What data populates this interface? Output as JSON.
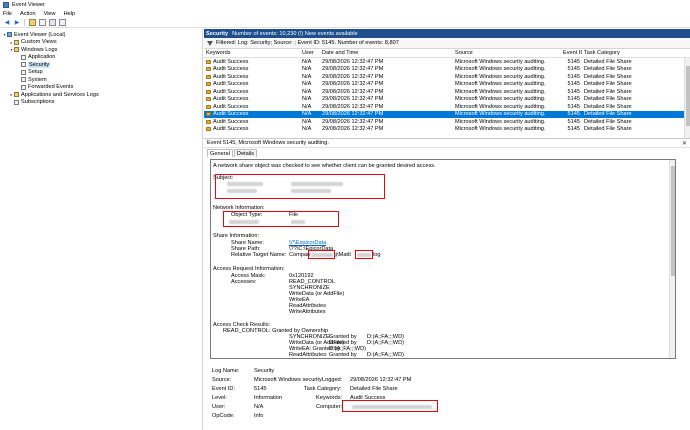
{
  "window": {
    "title": "Event Viewer"
  },
  "menu": [
    "File",
    "Action",
    "View",
    "Help"
  ],
  "toolbar": {
    "icons": [
      "back-arrow-icon",
      "forward-arrow-icon",
      "folder-icon",
      "properties-icon",
      "help-icon",
      "console-icon"
    ]
  },
  "tree": [
    {
      "label": "Event Viewer (Local)",
      "level": 0,
      "caret": "▾",
      "icon": "root"
    },
    {
      "label": "Custom Views",
      "level": 1,
      "caret": "▸",
      "icon": "folder"
    },
    {
      "label": "Windows Logs",
      "level": 1,
      "caret": "▾",
      "icon": "folder"
    },
    {
      "label": "Application",
      "level": 2,
      "caret": "",
      "icon": "log"
    },
    {
      "label": "Security",
      "level": 2,
      "caret": "",
      "icon": "log",
      "selected": true
    },
    {
      "label": "Setup",
      "level": 2,
      "caret": "",
      "icon": "log"
    },
    {
      "label": "System",
      "level": 2,
      "caret": "",
      "icon": "log"
    },
    {
      "label": "Forwarded Events",
      "level": 2,
      "caret": "",
      "icon": "log"
    },
    {
      "label": "Applications and Services Logs",
      "level": 1,
      "caret": "▸",
      "icon": "folder"
    },
    {
      "label": "Subscriptions",
      "level": 1,
      "caret": "",
      "icon": "log"
    }
  ],
  "pane": {
    "log_name": "Security",
    "event_count": "Number of events: 10,230 (!) New events available",
    "filter": "Filtered: Log: Security; Source: ; Event ID: 5145. Number of events: 8,807"
  },
  "grid": {
    "columns": [
      "Keywords",
      "User",
      "Date and Time",
      "Source",
      "Event ID",
      "Task Category"
    ],
    "rows": [
      [
        "Audit Success",
        "N/A",
        "29/08/2026 12:32:47 PM",
        "Microsoft Windows security auditing.",
        "5145",
        "Detailed File Share"
      ],
      [
        "Audit Success",
        "N/A",
        "29/08/2026 12:32:47 PM",
        "Microsoft Windows security auditing.",
        "5145",
        "Detailed File Share"
      ],
      [
        "Audit Success",
        "N/A",
        "29/08/2026 12:32:47 PM",
        "Microsoft Windows security auditing.",
        "5145",
        "Detailed File Share"
      ],
      [
        "Audit Success",
        "N/A",
        "29/08/2026 12:32:47 PM",
        "Microsoft Windows security auditing.",
        "5145",
        "Detailed File Share"
      ],
      [
        "Audit Success",
        "N/A",
        "29/08/2026 12:32:47 PM",
        "Microsoft Windows security auditing.",
        "5145",
        "Detailed File Share"
      ],
      [
        "Audit Success",
        "N/A",
        "29/08/2026 12:32:47 PM",
        "Microsoft Windows security auditing.",
        "5145",
        "Detailed File Share"
      ],
      [
        "Audit Success",
        "N/A",
        "29/08/2026 12:32:47 PM",
        "Microsoft Windows security auditing.",
        "5145",
        "Detailed File Share"
      ],
      [
        "Audit Success",
        "N/A",
        "29/08/2026 12:32:47 PM",
        "Microsoft Windows security auditing.",
        "5145",
        "Detailed File Share"
      ],
      [
        "Audit Success",
        "N/A",
        "29/08/2026 12:32:47 PM",
        "Microsoft Windows security auditing.",
        "5145",
        "Detailed File Share"
      ],
      [
        "Audit Success",
        "N/A",
        "29/08/2026 12:32:47 PM",
        "Microsoft Windows security auditing.",
        "5145",
        "Detailed File Share"
      ]
    ],
    "selected_index": 7
  },
  "detail": {
    "title": "Event 5145, Microsoft Windows security auditing.",
    "tabs": [
      "General",
      "Details"
    ],
    "description": {
      "intro": "A network share object was checked to see whether client can be granted desired access.",
      "subject_label": "Subject:",
      "network_label": "Network Information:",
      "object_type_label": "Object Type:",
      "object_type_value": "File",
      "share_label": "Share Information:",
      "share_name_label": "Share Name:",
      "share_name_value": "\\\\*\\ExpicorData",
      "share_path_label": "Share Path:",
      "share_path_value": "\\??\\C:\\EpicorData",
      "relative_label": "Relative Target Name:",
      "relative_prefix": "Compan",
      "relative_mid": "g\\Mattl",
      "relative_suffix": "log",
      "access_label": "Access Request Information:",
      "access_mask_label": "Access Mask:",
      "access_mask_value": "0x120192",
      "accesses_label": "Accesses:",
      "accesses": [
        "READ_CONTROL",
        "SYNCHRONIZE",
        "WriteData (or AddFile)",
        "WriteEA",
        "ReadAttributes",
        "WriteAttributes"
      ],
      "check_label": "Access Check Results:",
      "checks": [
        {
          "name": "READ_CONTROL: Granted by Ownership",
          "granted": "",
          "value": ""
        },
        {
          "name": "SYNCHRONIZE:",
          "granted": "Granted by",
          "value": "D:(A;;FA;;;WD)"
        },
        {
          "name": "WriteData (or AddFile):",
          "granted": "Granted by",
          "value": "D:(A;;FA;;;WD)"
        },
        {
          "name": "WriteEA: Granted by",
          "granted": "",
          "value": "D:(A;;FA;;;WD)"
        },
        {
          "name": "ReadAttributes:",
          "granted": "Granted by",
          "value": "D:(A;;FA;;;WD)"
        }
      ]
    },
    "properties": {
      "log_name_label": "Log Name:",
      "log_name_value": "Security",
      "source_label": "Source:",
      "source_value": "Microsoft Windows security",
      "logged_label": "Logged:",
      "logged_value": "29/08/2026 12:32:47 PM",
      "event_id_label": "Event ID:",
      "event_id_value": "5145",
      "task_label": "Task Category:",
      "task_value": "Detailed File Share",
      "level_label": "Level:",
      "level_value": "Information",
      "keywords_label": "Keywords:",
      "keywords_value": "Audit Success",
      "user_label": "User:",
      "user_value": "N/A",
      "computer_label": "Computer:",
      "opcode_label": "OpCode:",
      "opcode_value": "Info"
    }
  },
  "colors": {
    "accent": "#1e4e8c",
    "selection": "#0078d7",
    "highlight_box": "#e30613",
    "link": "#0066cc"
  }
}
